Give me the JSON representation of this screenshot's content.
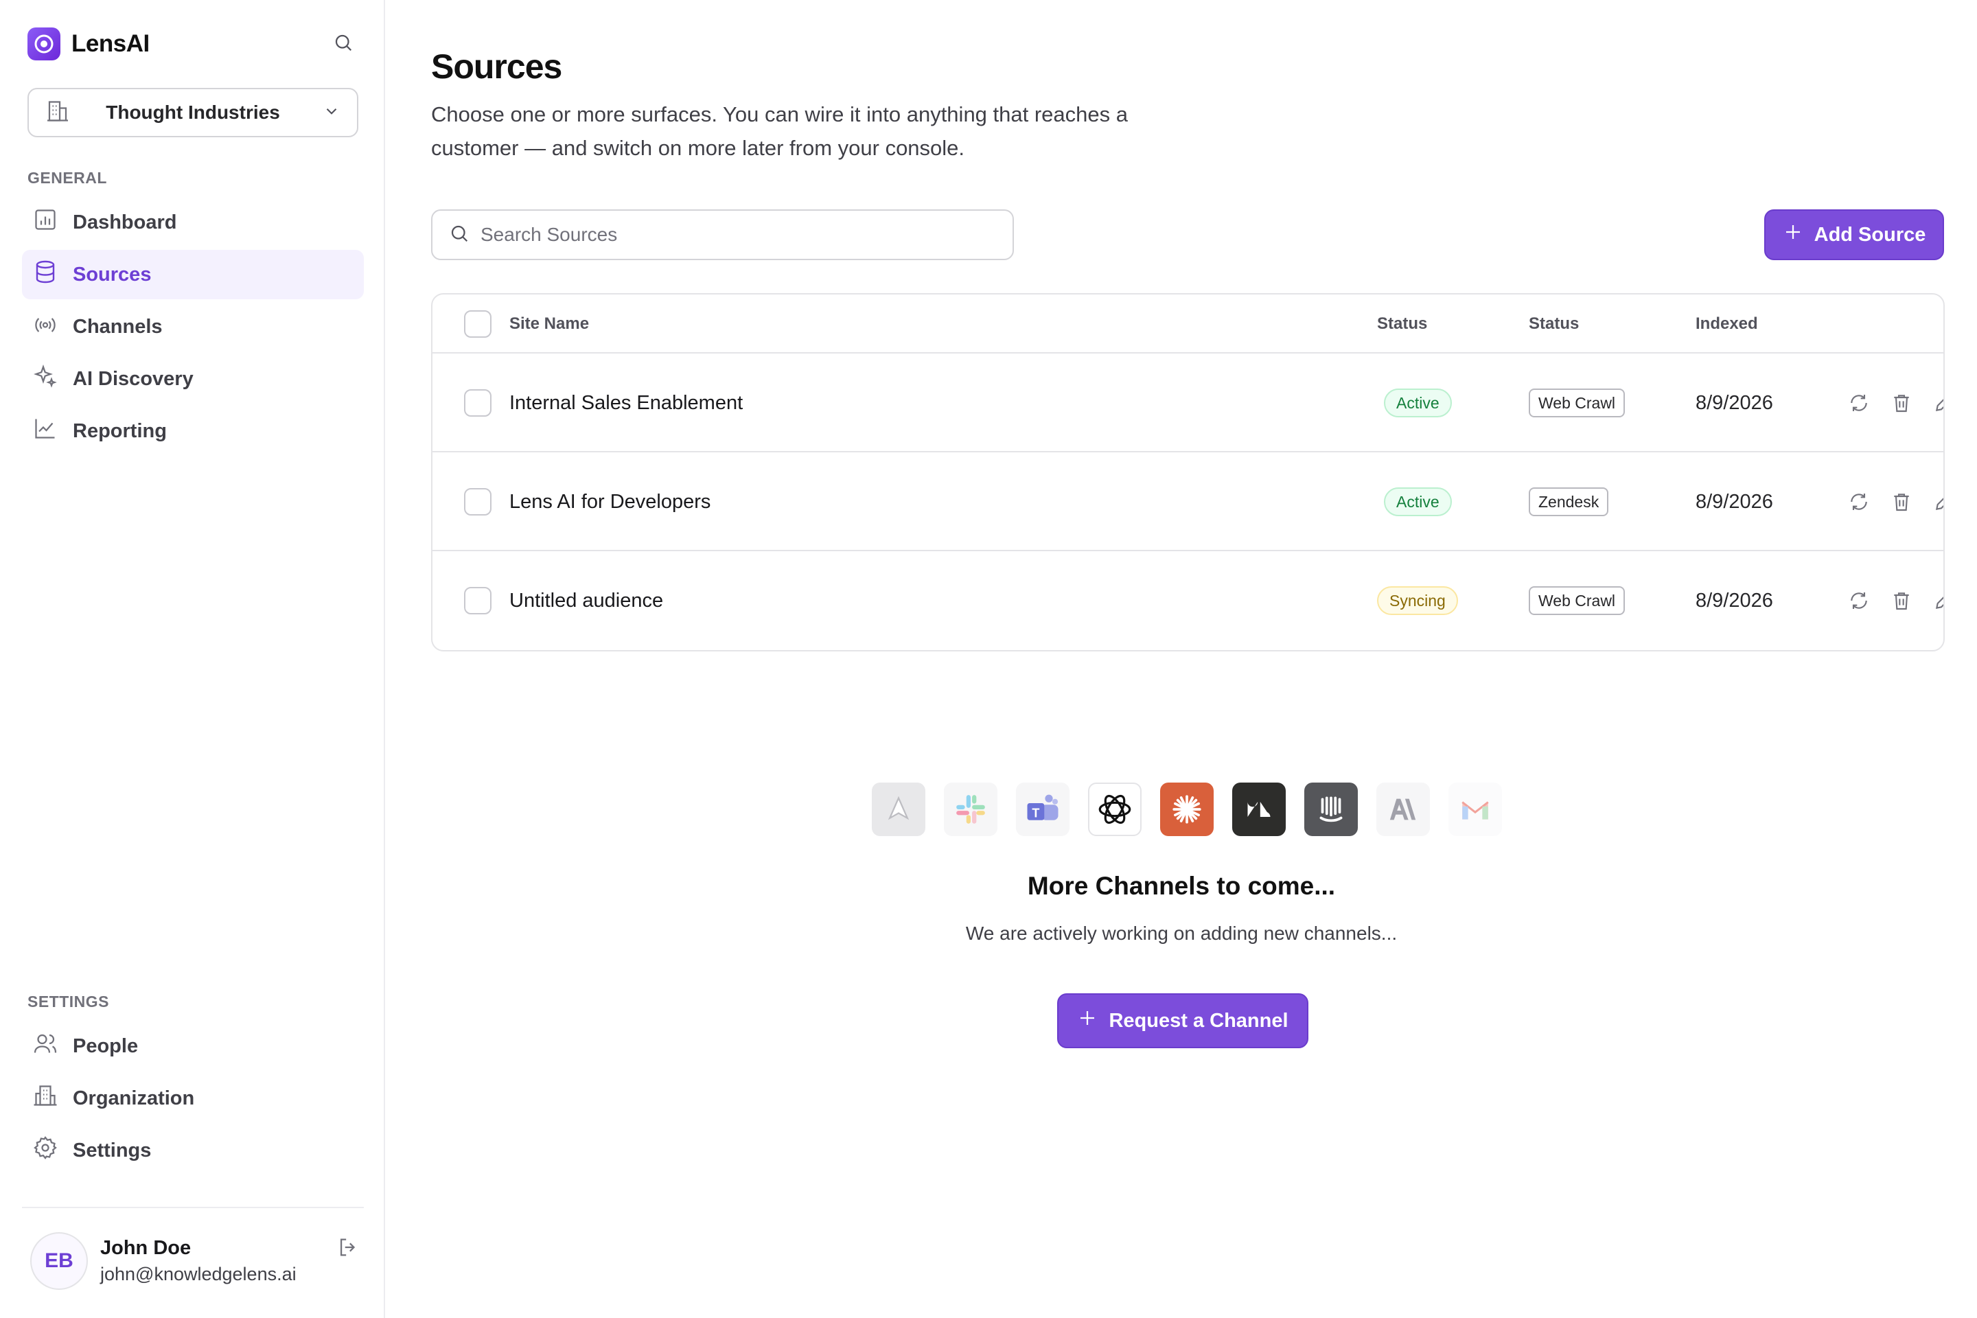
{
  "app": {
    "name": "LensAI"
  },
  "org_select": {
    "value": "Thought Industries"
  },
  "sidebar": {
    "general_label": "GENERAL",
    "general_items": [
      {
        "label": "Dashboard",
        "icon": "chart-bar-icon"
      },
      {
        "label": "Sources",
        "icon": "database-icon",
        "active": true
      },
      {
        "label": "Channels",
        "icon": "broadcast-icon"
      },
      {
        "label": "AI Discovery",
        "icon": "sparkles-icon"
      },
      {
        "label": "Reporting",
        "icon": "line-chart-icon"
      }
    ],
    "settings_label": "SETTINGS",
    "settings_items": [
      {
        "label": "People",
        "icon": "users-icon"
      },
      {
        "label": "Organization",
        "icon": "building-icon"
      },
      {
        "label": "Settings",
        "icon": "gear-icon"
      }
    ]
  },
  "user": {
    "initials": "EB",
    "name": "John Doe",
    "email": "john@knowledgelens.ai"
  },
  "page": {
    "title": "Sources",
    "description": "Choose one or more surfaces. You can wire it into anything that reaches a customer — and switch on more later from your console."
  },
  "search": {
    "placeholder": "Search Sources",
    "value": ""
  },
  "add_source_label": "Add Source",
  "table": {
    "columns": [
      "Site Name",
      "Status",
      "Status",
      "Indexed"
    ],
    "rows": [
      {
        "name": "Internal Sales Enablement",
        "status": "Active",
        "type": "Web Crawl",
        "indexed": "8/9/2026"
      },
      {
        "name": "Lens AI for Developers",
        "status": "Active",
        "type": "Zendesk",
        "indexed": "8/9/2026"
      },
      {
        "name": "Untitled audience",
        "status": "Syncing",
        "type": "Web Crawl",
        "indexed": "8/9/2026"
      }
    ]
  },
  "channels": {
    "icons": [
      "aws-icon",
      "slack-icon",
      "teams-icon",
      "openai-icon",
      "claude-icon",
      "zendesk-icon",
      "intercom-icon",
      "anthropic-icon",
      "gmail-icon"
    ],
    "title": "More Channels to come...",
    "subtitle": "We are actively working on adding new channels...",
    "request_label": "Request a Channel"
  },
  "colors": {
    "accent": "#7c4ddb",
    "active_nav_bg": "#f4f1fe",
    "active_pill": "#15803d",
    "syncing_pill": "#8a6a05"
  }
}
